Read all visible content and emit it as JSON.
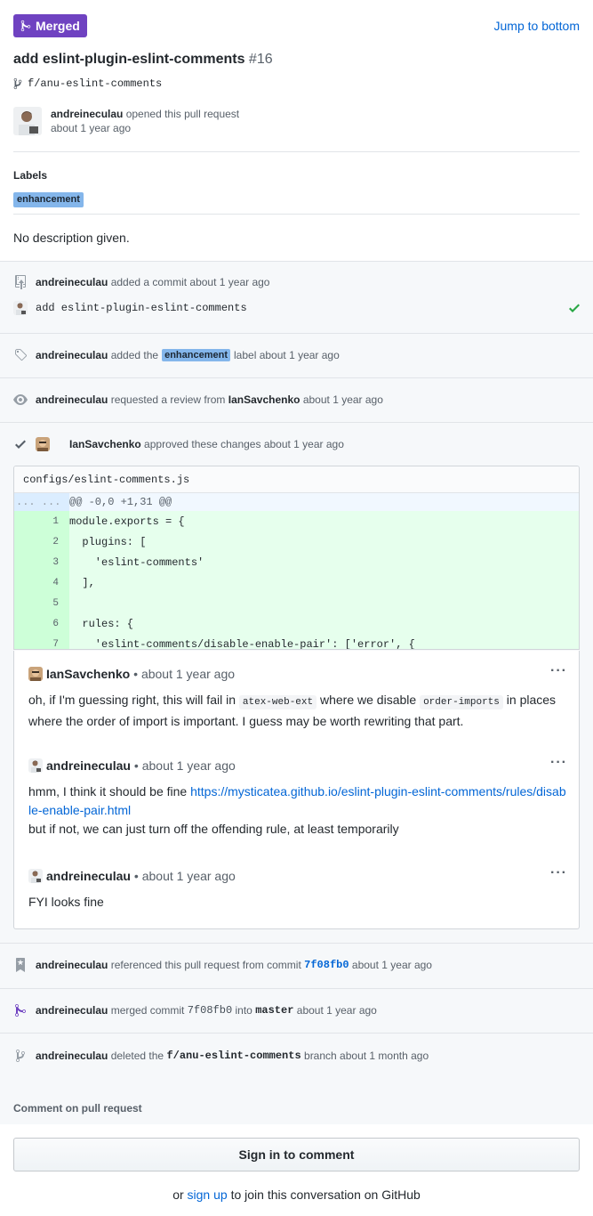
{
  "header": {
    "state_label": "Merged",
    "jump_label": "Jump to bottom",
    "title": "add eslint-plugin-eslint-comments",
    "number": "#16",
    "branch": "f/anu-eslint-comments",
    "author": "andreineculau",
    "opened_text": "opened this pull request",
    "opened_time": "about 1 year ago",
    "labels_heading": "Labels",
    "label": "enhancement",
    "description": "No description given."
  },
  "timeline": {
    "commit_event": {
      "actor": "andreineculau",
      "text": "added a commit about 1 year ago",
      "message": "add eslint-plugin-eslint-comments"
    },
    "label_event": {
      "actor": "andreineculau",
      "before": "added the",
      "label": "enhancement",
      "after": "label about 1 year ago"
    },
    "review_request_event": {
      "actor": "andreineculau",
      "before": "requested a review from",
      "reviewer": "IanSavchenko",
      "after": "about 1 year ago"
    },
    "approval_event": {
      "actor": "IanSavchenko",
      "text": "approved these changes about 1 year ago"
    },
    "diff": {
      "file": "configs/eslint-comments.js",
      "hunk_gutter": "... ...",
      "hunk": "@@ -0,0 +1,31 @@",
      "lines": [
        {
          "n": "1",
          "code": "module.exports = {"
        },
        {
          "n": "2",
          "code": "  plugins: ["
        },
        {
          "n": "3",
          "code": "    'eslint-comments'"
        },
        {
          "n": "4",
          "code": "  ],"
        },
        {
          "n": "5",
          "code": ""
        },
        {
          "n": "6",
          "code": "  rules: {"
        },
        {
          "n": "7",
          "code": "    'eslint-comments/disable-enable-pair': ['error', {"
        }
      ]
    },
    "comments": [
      {
        "author": "IanSavchenko",
        "meta": "• about 1 year ago",
        "p1": "oh, if I'm guessing right, this will fail in",
        "code1": "atex-web-ext",
        "p2": "where we disable",
        "code2": "order-imports",
        "p3": "in places where the order of import is important. I guess may be worth rewriting that part."
      },
      {
        "author": "andreineculau",
        "meta": "• about 1 year ago",
        "p1": "hmm, I think it should be fine",
        "link": "https://mysticatea.github.io/eslint-plugin-eslint-comments/rules/disable-enable-pair.html",
        "p2": "but if not, we can just turn off the offending rule, at least temporarily"
      },
      {
        "author": "andreineculau",
        "meta": "• about 1 year ago",
        "p1": "FYI looks fine"
      }
    ],
    "reference_event": {
      "actor": "andreineculau",
      "before": "referenced this pull request from commit",
      "sha": "7f08fb0",
      "after": "about 1 year ago"
    },
    "merge_event": {
      "actor": "andreineculau",
      "before": "merged commit",
      "sha": "7f08fb0",
      "mid": "into",
      "branch": "master",
      "after": "about 1 year ago"
    },
    "delete_event": {
      "actor": "andreineculau",
      "before": "deleted the",
      "branch": "f/anu-eslint-comments",
      "after": "branch about 1 month ago"
    }
  },
  "footer": {
    "heading": "Comment on pull request",
    "signin_label": "Sign in to comment",
    "or": "or",
    "signup": "sign up",
    "signup_tail": "to join this conversation on GitHub"
  },
  "colors": {
    "merged": "#6f42c1",
    "link": "#0366d6",
    "label": "#84b6eb",
    "added_line": "#e6ffed",
    "check": "#28a745"
  }
}
